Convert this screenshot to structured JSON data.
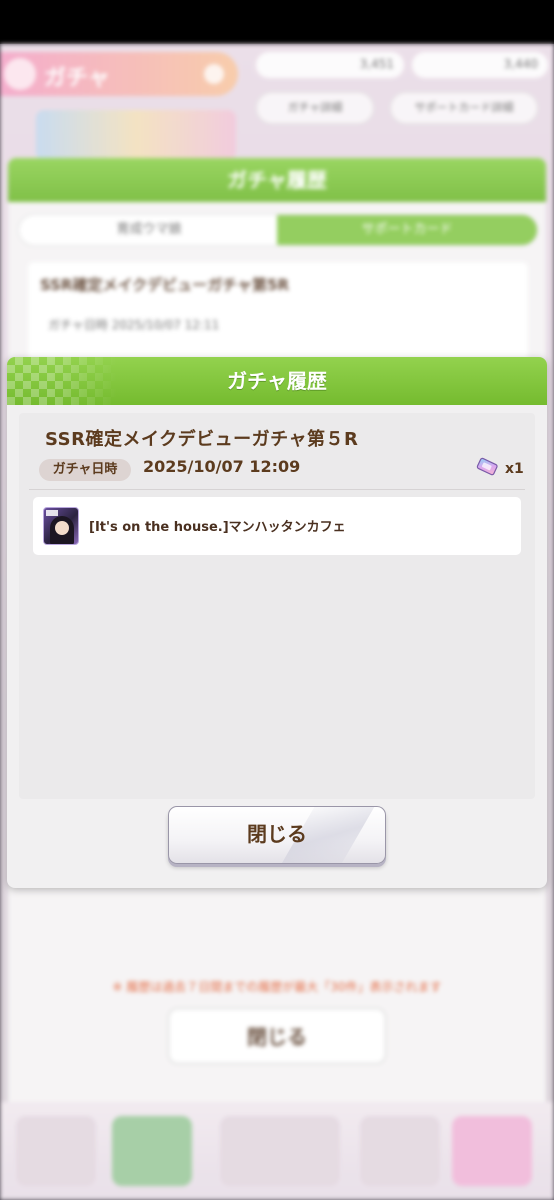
{
  "background": {
    "title": "ガチャ",
    "currency": [
      "3,451",
      "3,440"
    ],
    "buttons": [
      "ガチャ詳細",
      "サポートカード詳細"
    ],
    "panel_title": "ガチャ履歴",
    "tabs": [
      "育成ウマ娘",
      "サポートカード"
    ],
    "history_name": "SSR確定メイクデビューガチャ第5R",
    "history_date": "ガチャ日時 2025/10/07 12:11",
    "notice": "※ 履歴は過去７日間までの履歴が最大「30件」表示されます",
    "close_label": "閉じる"
  },
  "dialog": {
    "title": "ガチャ履歴",
    "gacha_name": "SSR確定メイクデビューガチャ第５R",
    "date_label": "ガチャ日時",
    "date_value": "2025/10/07 12:09",
    "ticket_icon": "ticket-icon",
    "ticket_count": "x1",
    "results": [
      {
        "name": "[It's on the house.]マンハッタンカフェ"
      }
    ],
    "close_label": "閉じる"
  },
  "colors": {
    "header_green": "#7cc23a",
    "text_brown": "#5c3b1e",
    "notice_orange": "#e05a2e"
  }
}
